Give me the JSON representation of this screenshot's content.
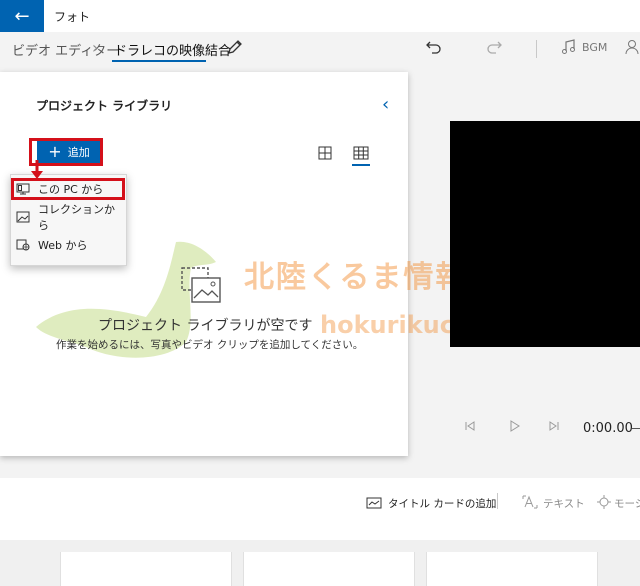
{
  "window": {
    "title": "フォト"
  },
  "breadcrumb": {
    "root": "ビデオ エディター",
    "current": "ドラレコの映像結合"
  },
  "toolbar": {
    "bgm_label": "BGM"
  },
  "library": {
    "title": "プロジェクト ライブラリ",
    "add_label": "追加",
    "menu": [
      {
        "label": "この PC から",
        "icon": "pc-icon"
      },
      {
        "label": "コレクションから",
        "icon": "collection-icon"
      },
      {
        "label": "Web から",
        "icon": "web-icon"
      }
    ],
    "empty_title": "プロジェクト ライブラリが空です",
    "empty_desc": "作業を始めるには、写真やビデオ クリップを追加してください。"
  },
  "watermark": {
    "title": "北陸くるま情報サイト",
    "url": "hokurikucar.com"
  },
  "player": {
    "time": "0:00.00"
  },
  "storyboard": {
    "title_card_label": "タイトル カードの追加",
    "text_label": "テキスト",
    "motion_label": "モーシ"
  },
  "colors": {
    "accent": "#0063b1",
    "highlight": "#d4101a",
    "watermark": "#f28a2b"
  }
}
